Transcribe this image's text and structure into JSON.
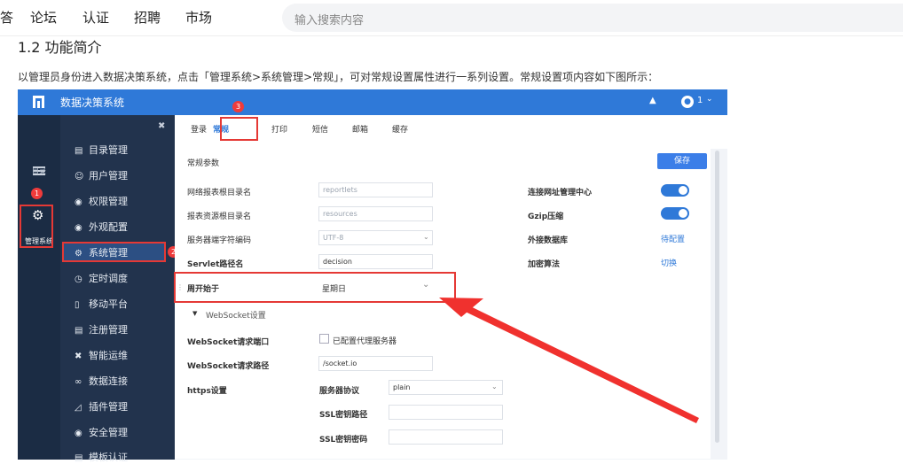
{
  "nav": {
    "items": [
      "答",
      "论坛",
      "认证",
      "招聘",
      "市场"
    ],
    "search_placeholder": "输入搜索内容"
  },
  "section_title": "1.2 功能简介",
  "intro": "以管理员身份进入数据决策系统，点击「管理系统>系统管理>常规」，可对常规设置属性进行一系列设置。常规设置项内容如下图所示：",
  "app": {
    "title": "数据决策系统",
    "user_num": "1",
    "rail": {
      "directory_label": "目录",
      "manage_label": "管理系统"
    },
    "sidebar": [
      "目录管理",
      "用户管理",
      "权限管理",
      "外观配置",
      "系统管理",
      "定时调度",
      "移动平台",
      "注册管理",
      "智能运维",
      "数据连接",
      "插件管理",
      "安全管理",
      "模板认证"
    ],
    "tabs": [
      "登录",
      "常规",
      "打印",
      "短信",
      "邮箱",
      "缓存"
    ],
    "section": "常规参数",
    "save": "保存",
    "fields": {
      "web_dir_label": "网络报表根目录名",
      "web_dir_value": "reportlets",
      "res_dir_label": "报表资源根目录名",
      "res_dir_value": "resources",
      "charset_label": "服务器端字符编码",
      "charset_value": "UTF-8",
      "servlet_label": "Servlet路径名",
      "servlet_value": "decision",
      "week_label": "周开始于",
      "week_value": "星期日",
      "ws_section": "WebSocket设置",
      "ws_port_label": "WebSocket请求端口",
      "ws_proxy_label": "已配置代理服务器",
      "ws_path_label": "WebSocket请求路径",
      "ws_path_value": "/socket.io",
      "https_label": "https设置",
      "protocol_label": "服务器协议",
      "protocol_value": "plain",
      "ssl_path_label": "SSL密钥路径",
      "ssl_pwd_label": "SSL密钥密码"
    },
    "right": {
      "conn_label": "连接网址管理中心",
      "gzip_label": "Gzip压缩",
      "ext_db_label": "外接数据库",
      "ext_db_link": "待配置",
      "encrypt_label": "加密算法",
      "encrypt_link": "切换"
    },
    "badges": [
      "1",
      "2",
      "3"
    ]
  },
  "colors": {
    "header_blue": "#2f79d8",
    "sidebar_dark": "#22334d",
    "highlight_red": "#e53935"
  }
}
